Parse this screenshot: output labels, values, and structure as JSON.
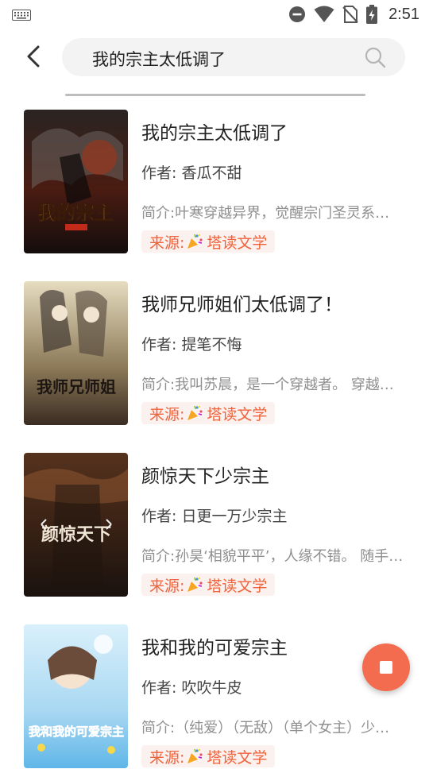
{
  "status_bar": {
    "time": "2:51"
  },
  "search": {
    "query": "我的宗主太低调了"
  },
  "results": [
    {
      "title": "我的宗主太低调了",
      "author": "作者: 香瓜不甜",
      "summary": "简介:叶寒穿越异界，觉醒宗门圣灵系统，开局收获一名绝世天才弟子",
      "source_prefix": "来源:",
      "source_name": "塔读文学",
      "cover_title": "我的宗主",
      "cover_colors": [
        "#1b1414",
        "#5a1d12",
        "#d8a23a"
      ]
    },
    {
      "title": "我师兄师姐们太低调了！",
      "author": "作者: 提笔不悔",
      "summary": "简介:我叫苏晨，是一个穿越者。 穿越到了一个修仙世界",
      "source_prefix": "来源:",
      "source_name": "塔读文学",
      "cover_title": "我师兄师姐",
      "cover_colors": [
        "#d9cfb1",
        "#6b5a3e",
        "#2a1f1a"
      ]
    },
    {
      "title": "颜惊天下少宗主",
      "author": "作者: 日更一万少宗主",
      "summary": "简介:孙昊‘相貌平平’，人缘不错。 随手一救便是绝世美女",
      "source_prefix": "来源:",
      "source_name": "塔读文学",
      "cover_title": "颜惊天下",
      "cover_colors": [
        "#3b2417",
        "#8a4d2b",
        "#1c1410"
      ]
    },
    {
      "title": "我和我的可爱宗主",
      "author": "作者: 吹吹牛皮",
      "summary": "简介:（纯爱）（无敌）（单个女主）少年带着系统穿越",
      "source_prefix": "来源:",
      "source_name": "塔读文学",
      "cover_title": "我和我的可爱宗主",
      "cover_colors": [
        "#bfe4f6",
        "#2f9fe0",
        "#f6d84a"
      ]
    }
  ],
  "colors": {
    "accent": "#f2623a",
    "fab": "#f36c4f"
  }
}
